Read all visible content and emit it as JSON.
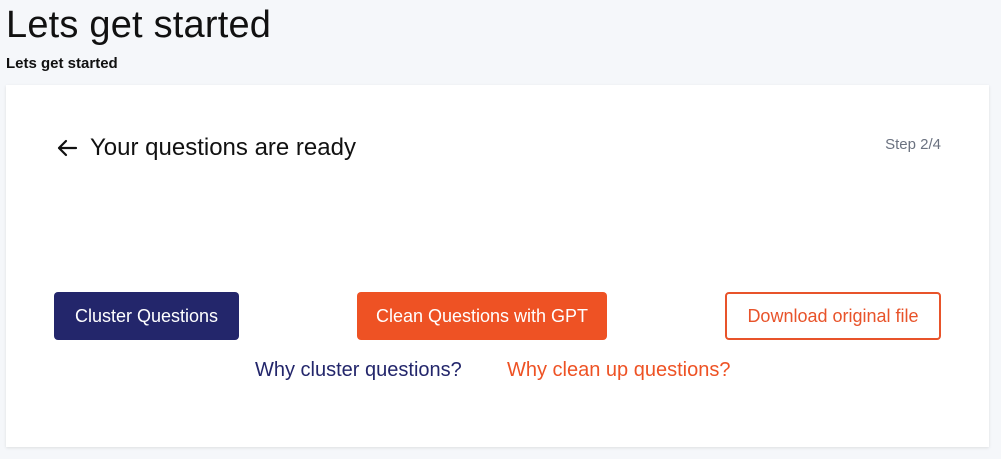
{
  "page": {
    "title": "Lets get started",
    "subtitle": "Lets get started"
  },
  "card": {
    "title": "Your questions are ready",
    "step": "Step 2/4",
    "back_icon": "arrow-left-icon"
  },
  "actions": {
    "cluster_label": "Cluster Questions",
    "clean_label": "Clean Questions with GPT",
    "download_label": "Download original file"
  },
  "links": {
    "why_cluster": "Why cluster questions?",
    "why_clean": "Why clean up questions?"
  },
  "colors": {
    "navy": "#23266b",
    "orange": "#ee5224",
    "background": "#f5f7fa",
    "muted_text": "#6b7280"
  }
}
